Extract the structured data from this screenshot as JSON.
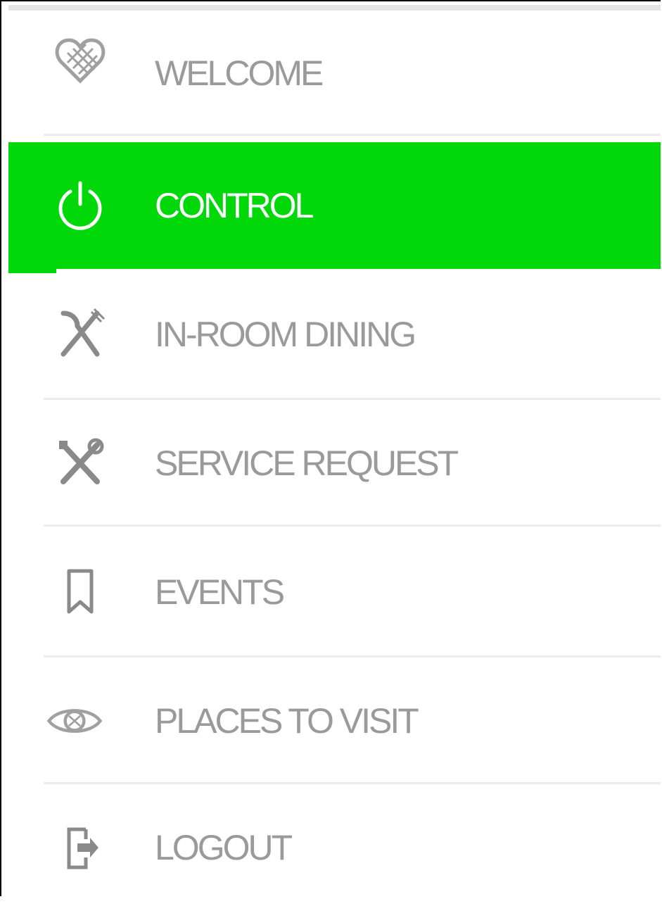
{
  "menu": {
    "items": [
      {
        "label": "WELCOME",
        "icon": "heart-gift-icon"
      },
      {
        "label": "CONTROL",
        "icon": "power-icon",
        "active": true
      },
      {
        "label": "IN-ROOM DINING",
        "icon": "fork-knife-icon"
      },
      {
        "label": "SERVICE REQUEST",
        "icon": "tools-icon"
      },
      {
        "label": "EVENTS",
        "icon": "bookmark-icon"
      },
      {
        "label": "PLACES TO VISIT",
        "icon": "eye-icon"
      },
      {
        "label": "LOGOUT",
        "icon": "logout-icon"
      }
    ]
  },
  "colors": {
    "accent": "#00d80a",
    "text": "#9a9a9a",
    "active_text": "#ffffff",
    "separator": "#ececec"
  }
}
